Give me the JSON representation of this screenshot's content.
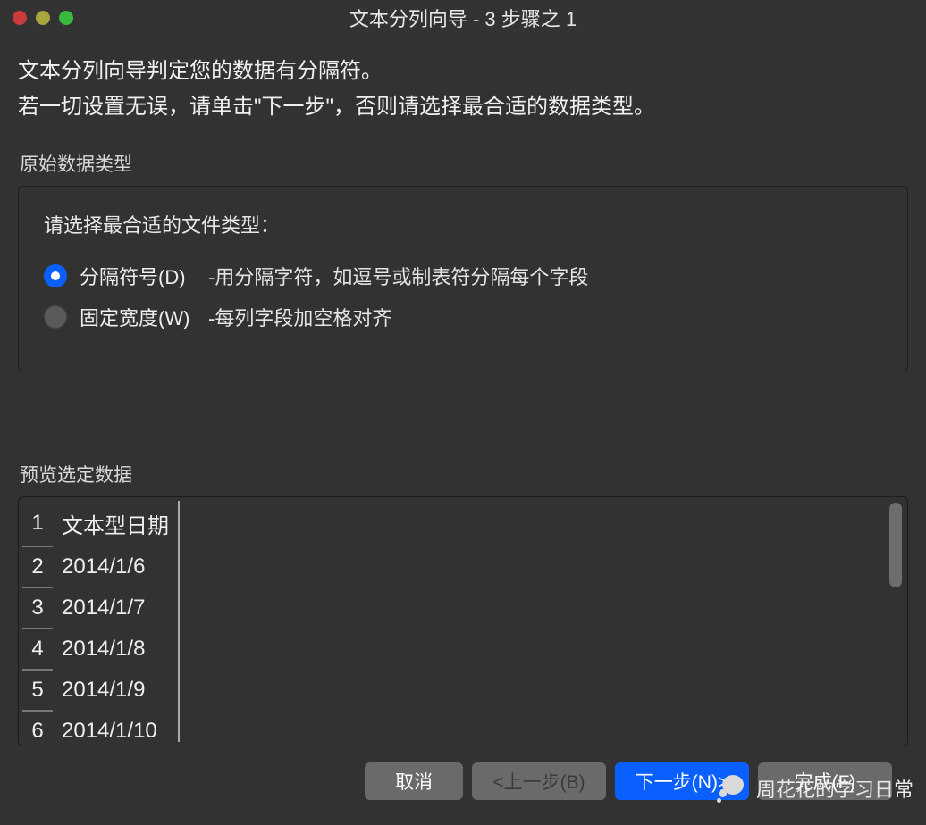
{
  "window": {
    "title": "文本分列向导 - 3 步骤之 1"
  },
  "intro": {
    "line1": "文本分列向导判定您的数据有分隔符。",
    "line2": "若一切设置无误，请单击\"下一步\"，否则请选择最合适的数据类型。"
  },
  "original_type": {
    "legend": "原始数据类型",
    "prompt": "请选择最合适的文件类型：",
    "options": [
      {
        "label": "分隔符号(D)",
        "desc": "-用分隔字符，如逗号或制表符分隔每个字段",
        "selected": true
      },
      {
        "label": "固定宽度(W)",
        "desc": "-每列字段加空格对齐",
        "selected": false
      }
    ]
  },
  "preview": {
    "legend": "预览选定数据",
    "rows": [
      {
        "n": "1",
        "v": "文本型日期"
      },
      {
        "n": "2",
        "v": "2014/1/6"
      },
      {
        "n": "3",
        "v": "2014/1/7"
      },
      {
        "n": "4",
        "v": "2014/1/8"
      },
      {
        "n": "5",
        "v": "2014/1/9"
      },
      {
        "n": "6",
        "v": "2014/1/10"
      }
    ]
  },
  "buttons": {
    "cancel": "取消",
    "back": "<上一步(B)",
    "next": "下一步(N)>",
    "finish": "完成(F)"
  },
  "watermark": {
    "text": "周花花的学习日常"
  }
}
